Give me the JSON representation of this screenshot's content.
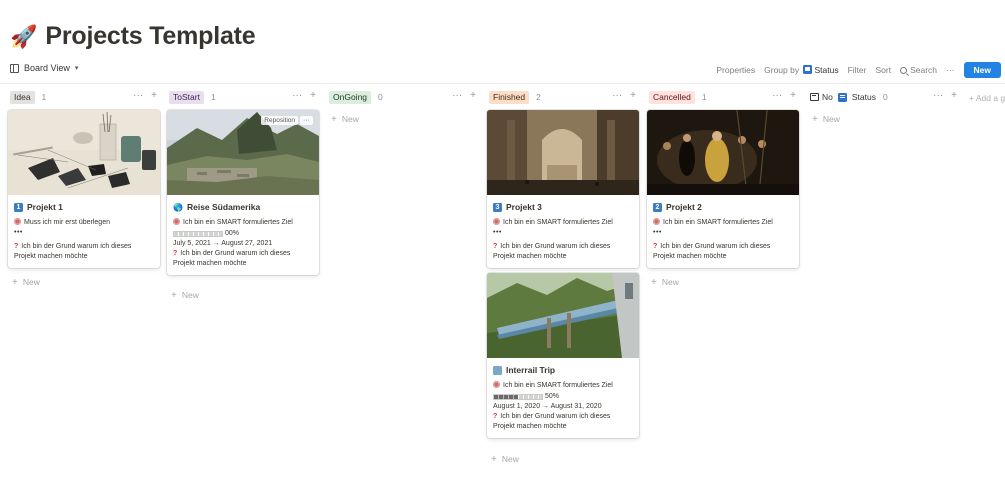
{
  "page": {
    "icon": "rocket-icon",
    "title": "Projects Template"
  },
  "toolbar": {
    "view_label": "Board View",
    "properties": "Properties",
    "group_by": "Group by",
    "status": "Status",
    "filter": "Filter",
    "sort": "Sort",
    "search": "Search",
    "more": "···",
    "new": "New"
  },
  "columns": [
    {
      "tag": "Idea",
      "count": "1",
      "tag_bg": "#e3e2e0",
      "tag_fg": "#37352f"
    },
    {
      "tag": "ToStart",
      "count": "1",
      "tag_bg": "#e8deee",
      "tag_fg": "#412454"
    },
    {
      "tag": "OnGoing",
      "count": "0",
      "tag_bg": "#dbeddb",
      "tag_fg": "#1c3829"
    },
    {
      "tag": "Finished",
      "count": "2",
      "tag_bg": "#fadec9",
      "tag_fg": "#49290e"
    },
    {
      "tag": "Cancelled",
      "count": "1",
      "tag_bg": "#ffe2dd",
      "tag_fg": "#5d1715"
    },
    {
      "tag": "No",
      "status": "Status",
      "count": "0"
    }
  ],
  "cards": {
    "projekt1": {
      "num": "1",
      "title": "Projekt 1",
      "goal": "Muss ich mir erst überlegen",
      "dashes": "•••",
      "reason": "Ich bin der Grund warum ich dieses Projekt machen möchte"
    },
    "reise": {
      "title": "Reise Südamerika",
      "goal": "Ich bin ein SMART formuliertes Ziel",
      "progress_value": 0,
      "progress_text": "00%",
      "dates": "July 5, 2021 → August 27, 2021",
      "reason": "Ich bin der Grund warum ich dieses Projekt machen möchte",
      "reposition": "Reposition",
      "more": "···"
    },
    "projekt3": {
      "num": "3",
      "title": "Projekt 3",
      "goal": "Ich bin ein SMART formuliertes Ziel",
      "dashes": "•••",
      "reason": "Ich bin der Grund warum ich dieses Projekt machen möchte"
    },
    "interrail": {
      "title": "Interrail Trip",
      "goal": "Ich bin ein SMART formuliertes Ziel",
      "progress_value": 50,
      "progress_text": "50%",
      "dates": "August 1, 2020 → August 31, 2020",
      "reason": "Ich bin der Grund warum ich dieses Projekt machen möchte"
    },
    "projekt2": {
      "num": "2",
      "title": "Projekt 2",
      "goal": "Ich bin ein SMART formuliertes Ziel",
      "dashes": "•••",
      "reason": "Ich bin der Grund warum ich dieses Projekt machen möchte"
    }
  },
  "new_label": "New",
  "add_group": "+ Add a gr"
}
